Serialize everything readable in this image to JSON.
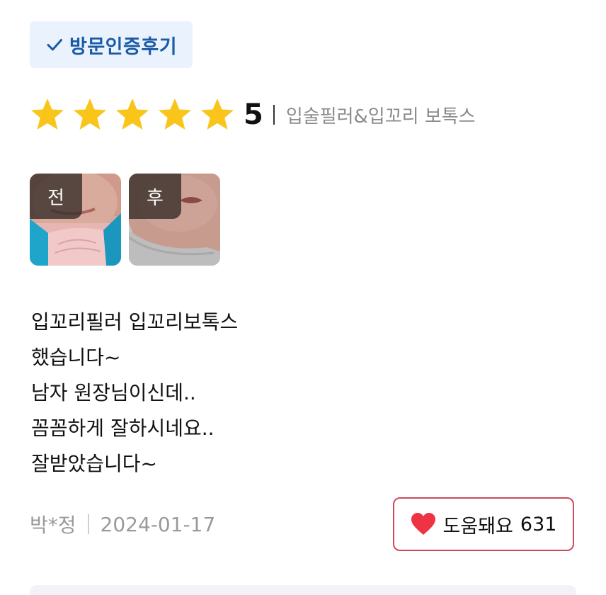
{
  "badge": {
    "label": "방문인증후기",
    "icon": "check-icon",
    "color": "#1b5aa6",
    "background": "#eaf3fd"
  },
  "rating": {
    "stars": 5,
    "max_stars": 5,
    "value": "5",
    "star_color": "#f9c51b",
    "procedure": "입술필러&입꼬리 보톡스"
  },
  "photos": [
    {
      "label": "전"
    },
    {
      "label": "후"
    }
  ],
  "review": {
    "lines": [
      "입꼬리필러 입꼬리보톡스",
      "했습니다~",
      "남자 원장님이신데..",
      "꼼꼼하게 잘하시네요..",
      "잘받았습니다~"
    ]
  },
  "meta": {
    "author": "박*정",
    "date": "2024-01-17"
  },
  "helpful": {
    "label": "도움돼요",
    "count": "631",
    "icon": "heart-icon",
    "accent": "#ee3344"
  }
}
